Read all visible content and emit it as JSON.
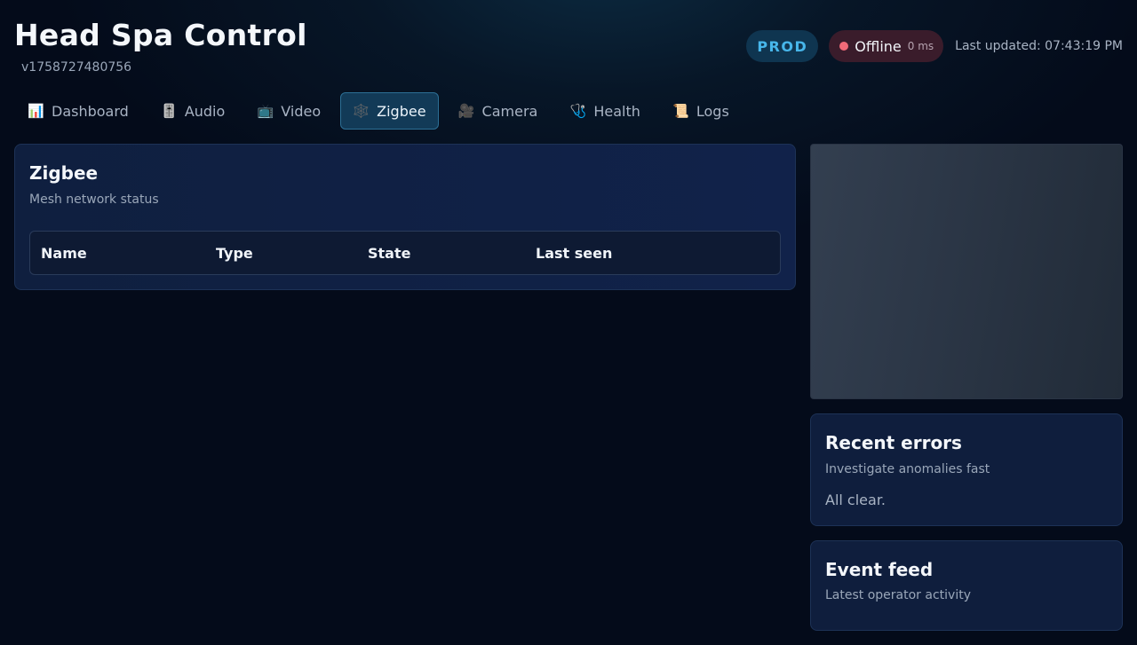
{
  "header": {
    "title": "Head Spa Control",
    "version": "v1758727480756",
    "env_badge": "PROD",
    "status": "Offline",
    "latency": "0 ms",
    "last_updated": "Last updated: 07:43:19 PM"
  },
  "tabs": [
    {
      "label": "Dashboard",
      "icon": "chart-icon",
      "glyph": "📊"
    },
    {
      "label": "Audio",
      "icon": "audio-mixer-icon",
      "glyph": "🎚️"
    },
    {
      "label": "Video",
      "icon": "tv-icon",
      "glyph": "📺"
    },
    {
      "label": "Zigbee",
      "icon": "network-icon",
      "glyph": "🕸️",
      "active": true
    },
    {
      "label": "Camera",
      "icon": "camera-icon",
      "glyph": "🎥"
    },
    {
      "label": "Health",
      "icon": "stethoscope-icon",
      "glyph": "🩺"
    },
    {
      "label": "Logs",
      "icon": "scroll-icon",
      "glyph": "📜"
    }
  ],
  "zigbee": {
    "title": "Zigbee",
    "subtitle": "Mesh network status",
    "columns": [
      "Name",
      "Type",
      "State",
      "Last seen"
    ]
  },
  "errors": {
    "title": "Recent errors",
    "subtitle": "Investigate anomalies fast",
    "empty": "All clear."
  },
  "feed": {
    "title": "Event feed",
    "subtitle": "Latest operator activity"
  },
  "colors": {
    "accent": "#47b6ea",
    "status_offline": "#f06a78",
    "panel_bg": "#0f1e3d"
  }
}
